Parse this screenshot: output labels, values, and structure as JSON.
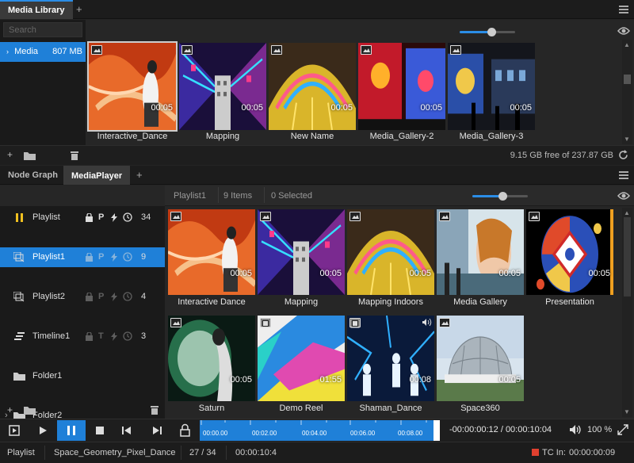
{
  "top_tabs": {
    "active": "Media Library"
  },
  "library": {
    "search_placeholder": "Search",
    "tree": [
      {
        "label": "Media",
        "size": "807 MB"
      }
    ],
    "thumbs": [
      {
        "name": "Interactive_Dance",
        "duration": "00:05",
        "theme": "orange"
      },
      {
        "name": "Mapping",
        "duration": "00:05",
        "theme": "neon"
      },
      {
        "name": "New Name",
        "duration": "00:05",
        "theme": "yellow"
      },
      {
        "name": "Media_Gallery-2",
        "duration": "00:05",
        "theme": "red"
      },
      {
        "name": "Media_Gallery-3",
        "duration": "00:05",
        "theme": "gallery"
      }
    ],
    "free_space": "9.15 GB free of 237.87 GB"
  },
  "bottom_tabs": [
    {
      "label": "Node Graph"
    },
    {
      "label": "MediaPlayer",
      "active": true
    }
  ],
  "player": {
    "header": {
      "playlist": "Playlist1",
      "items": "9 Items",
      "selected": "0 Selected"
    },
    "tree": [
      {
        "label": "Playlist",
        "count": "34",
        "kind": "pause",
        "flag": "P"
      },
      {
        "label": "Playlist1",
        "count": "9",
        "kind": "playlist",
        "flag": "P",
        "selected": true
      },
      {
        "label": "Playlist2",
        "count": "4",
        "kind": "playlist",
        "flag": "P"
      },
      {
        "label": "Timeline1",
        "count": "3",
        "kind": "timeline",
        "flag": "T"
      },
      {
        "label": "Folder1",
        "kind": "folder"
      },
      {
        "label": "Folder2",
        "kind": "folder"
      }
    ],
    "thumbs": [
      {
        "name": "Interactive Dance",
        "duration": "00:05",
        "theme": "orange",
        "type": "image"
      },
      {
        "name": "Mapping",
        "duration": "00:05",
        "theme": "neon",
        "type": "image"
      },
      {
        "name": "Mapping Indoors",
        "duration": "00:05",
        "theme": "yellow",
        "type": "image"
      },
      {
        "name": "Media Gallery",
        "duration": "00:05",
        "theme": "venus",
        "type": "image"
      },
      {
        "name": "Presentation",
        "duration": "00:05",
        "theme": "present",
        "type": "image"
      },
      {
        "name": "Saturn",
        "duration": "00:05",
        "theme": "saturn",
        "type": "image"
      },
      {
        "name": "Demo Reel",
        "duration": "01:55",
        "theme": "demo",
        "type": "video"
      },
      {
        "name": "Shaman_Dance",
        "duration": "00:08",
        "theme": "shaman",
        "type": "video"
      },
      {
        "name": "Space360",
        "duration": "00:05",
        "theme": "dome",
        "type": "image"
      }
    ]
  },
  "transport": {
    "ruler": [
      "00:00.00",
      "00:02.00",
      "00:04.00",
      "00:06.00",
      "00:08.00"
    ],
    "timecode": "-00:00:00:12 / 00:00:10:04",
    "volume": "100 %"
  },
  "status": {
    "mode": "Playlist",
    "clip": "Space_Geometry_Pixel_Dance",
    "position": "27 / 34",
    "duration": "00:00:10:4",
    "tc_label": "TC In:",
    "tc_value": "00:00:00:09"
  },
  "colors": {
    "accent": "#1f80d8",
    "record": "#e0402f"
  }
}
